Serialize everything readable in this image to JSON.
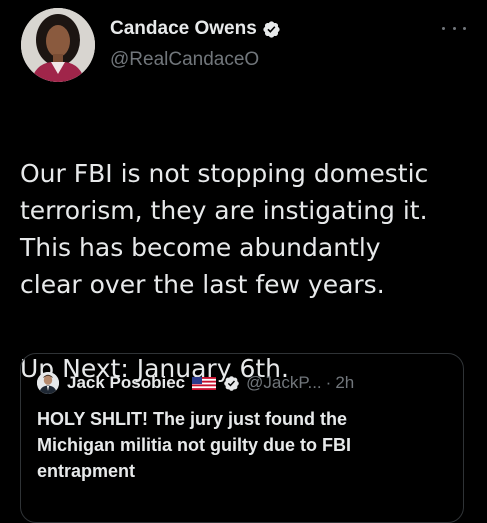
{
  "author": {
    "display_name": "Candace Owens",
    "handle": "@RealCandaceO",
    "verified": true
  },
  "tweet": {
    "text": "Our FBI is not stopping domestic\nterrorism, they are instigating it.\nThis has become abundantly\nclear over the last few years.",
    "text_2": "Up Next: January 6th."
  },
  "quoted_tweet": {
    "display_name": "Jack Posobiec",
    "flag": "us-flag-icon",
    "handle": "@JackP...",
    "separator": "·",
    "time": "2h",
    "text": "HOLY SHLIT! The jury just found the\nMichigan militia not guilty due to FBI\nentrapment"
  },
  "colors": {
    "background": "#000000",
    "text_primary": "#e7e9ea",
    "text_secondary": "#71767b",
    "border": "#2f3336",
    "verified_badge": "#e7e9ea"
  }
}
